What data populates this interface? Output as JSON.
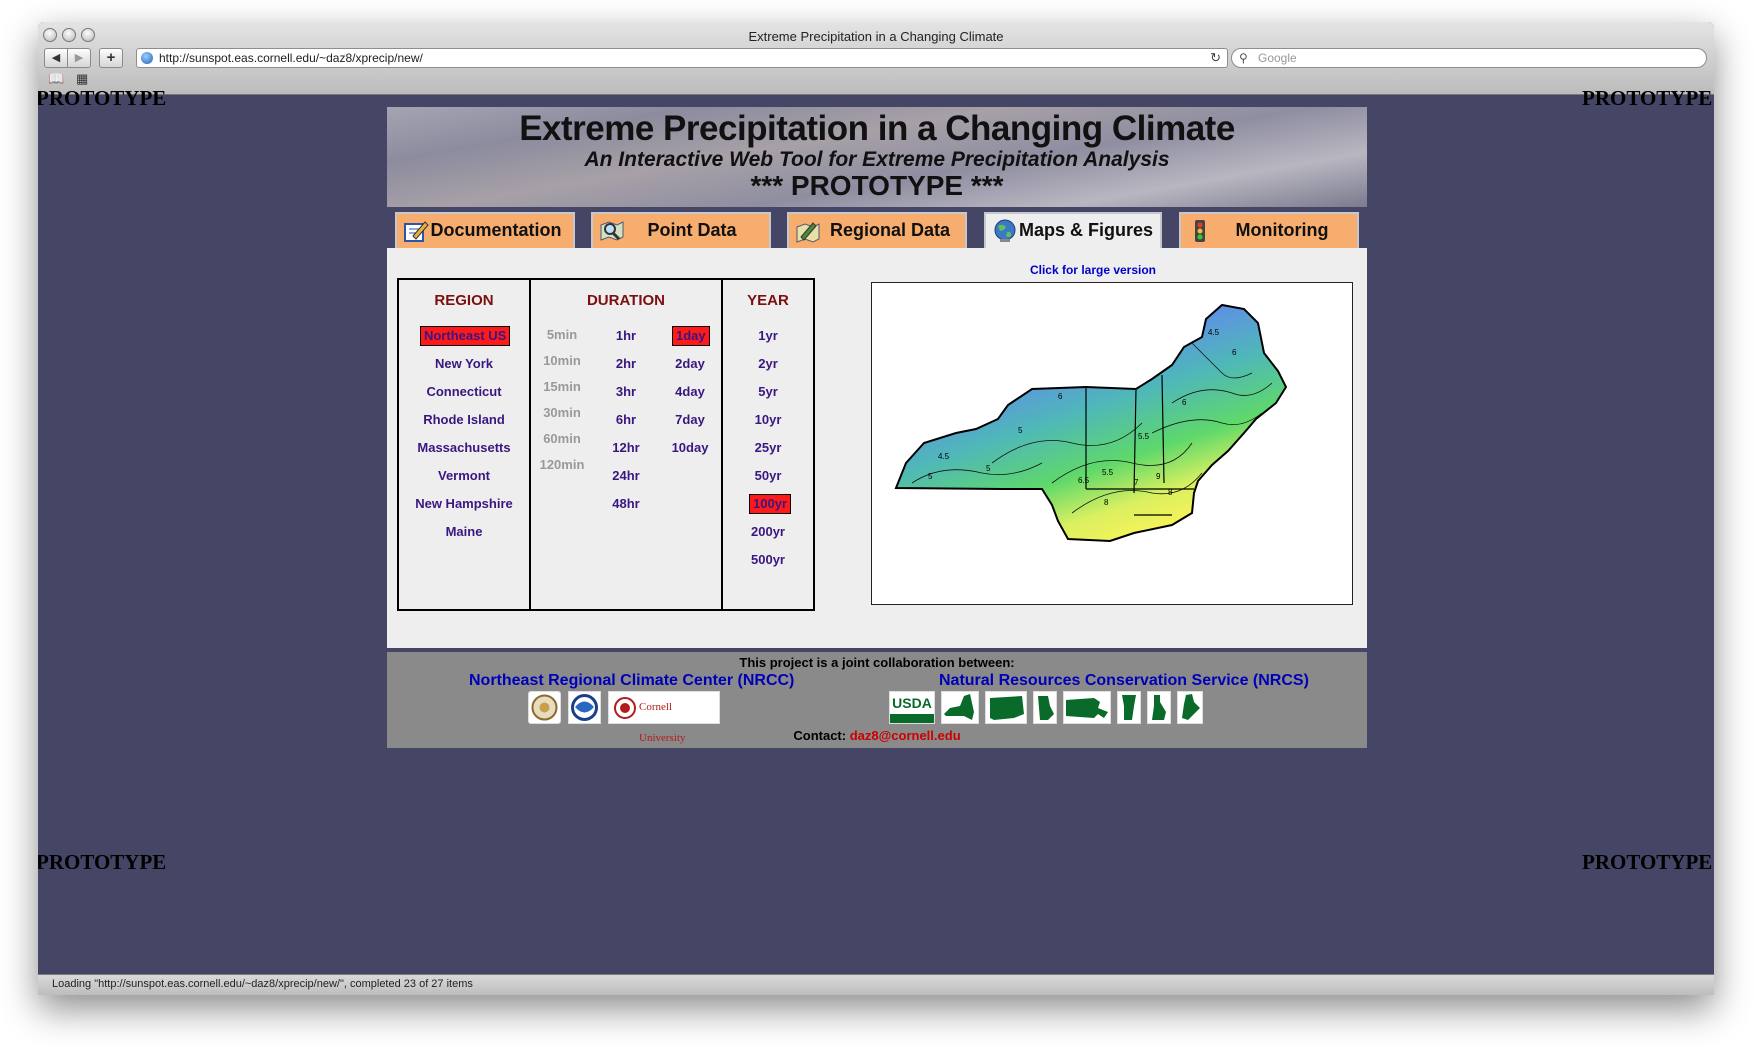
{
  "browser": {
    "window_title": "Extreme Precipitation in a Changing Climate",
    "url": "http://sunspot.eas.cornell.edu/~daz8/xprecip/new/",
    "search_placeholder": "Google",
    "status": "Loading \"http://sunspot.eas.cornell.edu/~daz8/xprecip/new/\", completed 23 of 27 items",
    "nav_back": "◀",
    "nav_fwd": "▶",
    "add_bookmark": "+",
    "reload": "↻",
    "bookmarks_icon": "📖",
    "topsites_icon": "▦"
  },
  "watermark": "PROTOTYPE",
  "banner": {
    "title": "Extreme Precipitation in a Changing Climate",
    "subtitle": "An Interactive Web Tool for Extreme Precipitation Analysis",
    "prototype": "*** PROTOTYPE ***"
  },
  "tabs": [
    {
      "label": "Documentation",
      "icon": "pencil-notepad-icon"
    },
    {
      "label": "Point Data",
      "icon": "magnifier-map-icon"
    },
    {
      "label": "Regional Data",
      "icon": "map-pencil-icon"
    },
    {
      "label": "Maps & Figures",
      "icon": "globe-icon",
      "active": true
    },
    {
      "label": "Monitoring",
      "icon": "traffic-light-icon"
    }
  ],
  "selector": {
    "region_header": "REGION",
    "duration_header": "DURATION",
    "year_header": "YEAR",
    "regions": [
      "Northeast US",
      "New York",
      "Connecticut",
      "Rhode Island",
      "Massachusetts",
      "Vermont",
      "New Hampshire",
      "Maine"
    ],
    "selected_region": "Northeast US",
    "durations_minutes": [
      "5min",
      "10min",
      "15min",
      "30min",
      "60min",
      "120min"
    ],
    "durations_hours": [
      "1hr",
      "2hr",
      "3hr",
      "6hr",
      "12hr",
      "24hr",
      "48hr"
    ],
    "durations_days": [
      "1day",
      "2day",
      "4day",
      "7day",
      "10day"
    ],
    "selected_duration": "1day",
    "years": [
      "1yr",
      "2yr",
      "5yr",
      "10yr",
      "25yr",
      "50yr",
      "100yr",
      "200yr",
      "500yr"
    ],
    "selected_year": "100yr"
  },
  "map": {
    "link": "Click for large version",
    "contour_labels": [
      "4.5",
      "5",
      "5.5",
      "6",
      "6.5",
      "7",
      "8",
      "9",
      "6",
      "5",
      "4.5",
      "5",
      "5.5",
      "6",
      "8"
    ]
  },
  "footer": {
    "heading": "This project is a joint collaboration between:",
    "partner1": "Northeast Regional Climate Center (NRCC)",
    "partner2": "Natural Resources Conservation Service (NRCS)",
    "usda_logo": "USDA",
    "cornell_logo": "Cornell University",
    "contact_label": "Contact:",
    "contact_email": "daz8@cornell.edu"
  }
}
